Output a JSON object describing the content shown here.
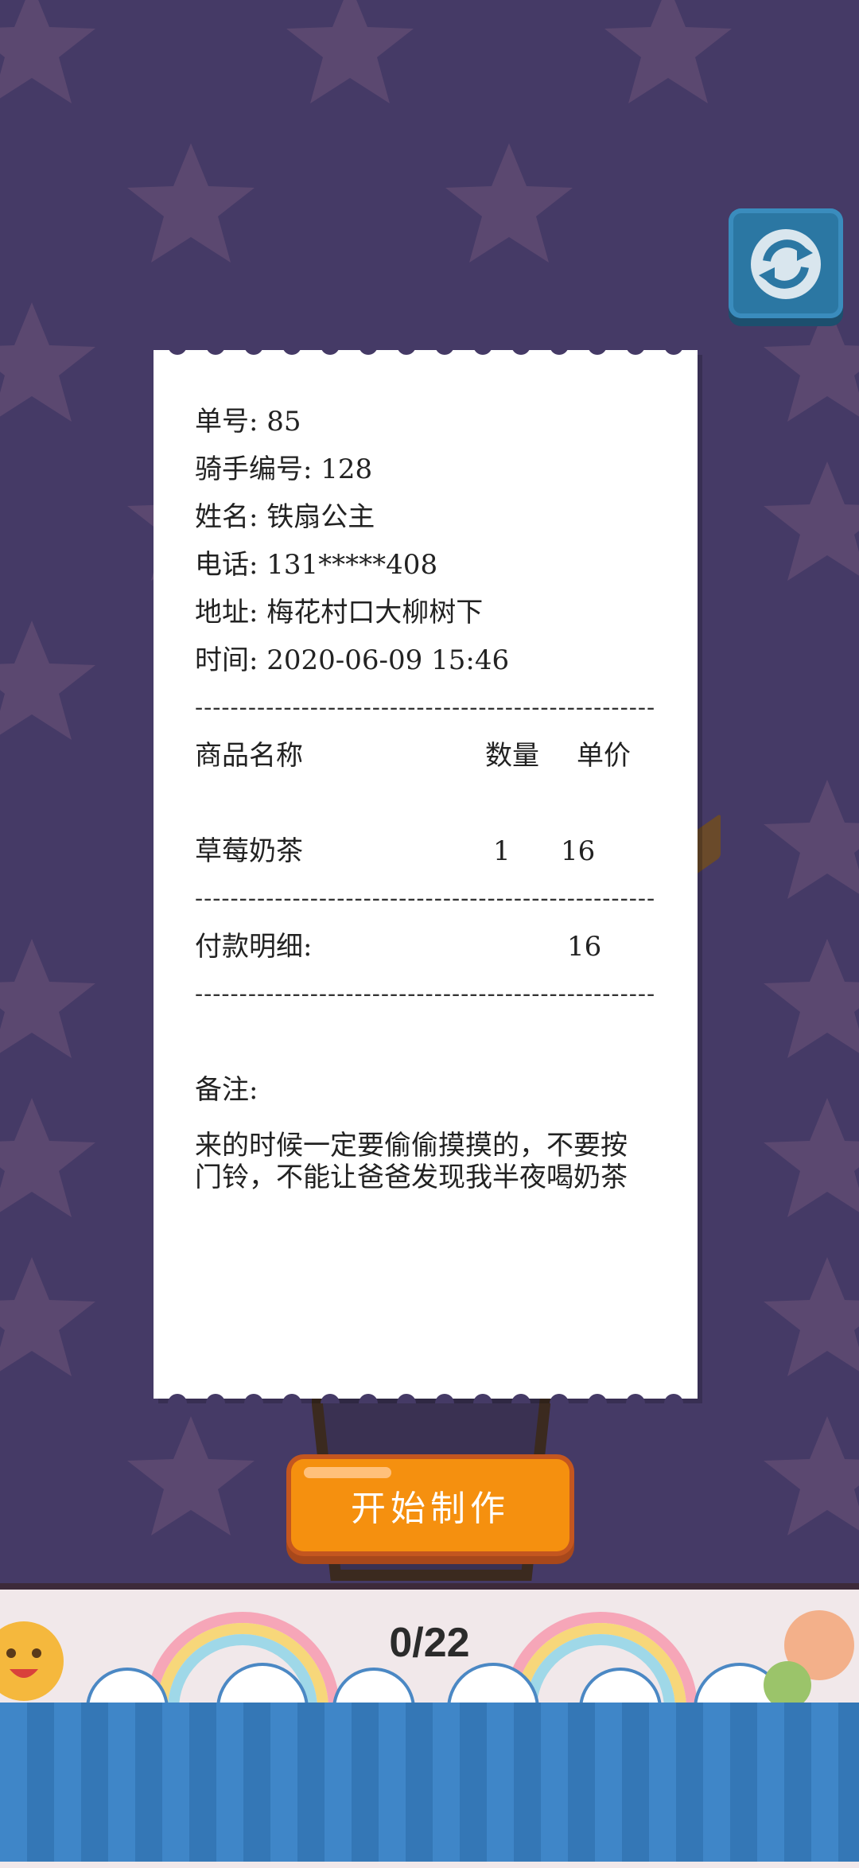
{
  "refresh_button": {
    "icon": "refresh-icon"
  },
  "receipt": {
    "order_no_label": "单号:",
    "order_no": "85",
    "rider_label": "骑手编号:",
    "rider_no": "128",
    "name_label": "姓名:",
    "name": "铁扇公主",
    "phone_label": "电话:",
    "phone": "131*****408",
    "address_label": "地址:",
    "address": "梅花村口大柳树下",
    "time_label": "时间:",
    "time": "2020-06-09 15:46",
    "divider": "----------------------------------------------------",
    "col_item": "商品名称",
    "col_qty": "数量",
    "col_price": "单价",
    "items": [
      {
        "name": "草莓奶茶",
        "qty": "1",
        "price": "16"
      }
    ],
    "payment_label": "付款明细:",
    "payment_total": "16",
    "note_label": "备注:",
    "note": "来的时候一定要偷偷摸摸的，不要按门铃，不能让爸爸发现我半夜喝奶茶"
  },
  "start_button": {
    "label": "开始制作"
  },
  "progress": {
    "text": "0/22"
  },
  "colors": {
    "background": "#453a66",
    "button": "#f5900f",
    "refresh": "#2b77a3"
  }
}
